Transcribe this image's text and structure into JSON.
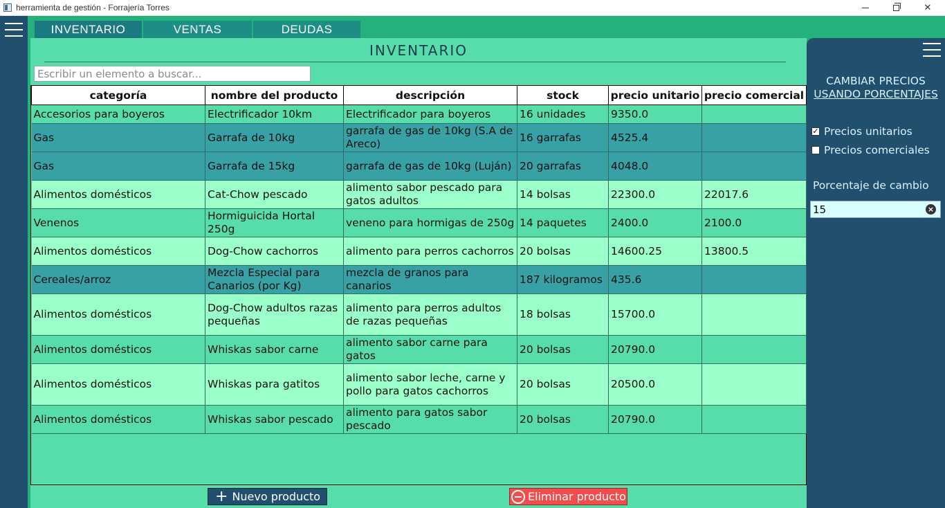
{
  "window": {
    "title": "herramienta de gestión - Forrajería Torres",
    "icon": "app-window-icon"
  },
  "tabs": [
    {
      "label": "INVENTARIO",
      "active": true
    },
    {
      "label": "VENTAS",
      "active": false
    },
    {
      "label": "DEUDAS",
      "active": false
    }
  ],
  "page": {
    "title": "INVENTARIO",
    "search_placeholder": "Escribir un elemento a buscar..."
  },
  "table": {
    "columns": [
      "categoría",
      "nombre del producto",
      "descripción",
      "stock",
      "precio unitario",
      "precio comercial"
    ],
    "rows": [
      {
        "color": "mint",
        "cells": [
          "Accesorios para boyeros",
          "Electrificador 10km",
          "Electrificador para boyeros",
          "16 unidades",
          "9350.0",
          ""
        ]
      },
      {
        "color": "teal",
        "cells": [
          "Gas",
          "Garrafa de 10kg",
          "garrafa de gas de 10kg (S.A de Areco)",
          "16 garrafas",
          "4525.4",
          ""
        ]
      },
      {
        "color": "teal",
        "cells": [
          "Gas",
          "Garrafa de 15kg",
          "garrafa de gas de 10kg (Luján)",
          "20 garrafas",
          "4048.0",
          ""
        ]
      },
      {
        "color": "light",
        "cells": [
          "Alimentos domésticos",
          "Cat-Chow pescado",
          "alimento sabor pescado para gatos adultos",
          "14 bolsas",
          "22300.0",
          "22017.6"
        ]
      },
      {
        "color": "mint",
        "cells": [
          "Venenos",
          "Hormiguicida Hortal 250g",
          "veneno para hormigas de 250g",
          "14 paquetes",
          "2400.0",
          "2100.0"
        ]
      },
      {
        "color": "light",
        "cells": [
          "Alimentos domésticos",
          "Dog-Chow cachorros",
          "alimento para perros cachorros",
          "20 bolsas",
          "14600.25",
          "13800.5"
        ]
      },
      {
        "color": "teal",
        "cells": [
          "Cereales/arroz",
          "Mezcla Especial para Canarios (por Kg)",
          "mezcla de granos para canarios",
          "187 kilogramos",
          "435.6",
          ""
        ]
      },
      {
        "color": "light",
        "cells": [
          "Alimentos domésticos",
          "Dog-Chow adultos razas pequeñas",
          "alimento para perros adultos de razas pequeñas",
          "18 bolsas",
          "15700.0",
          ""
        ]
      },
      {
        "color": "mint",
        "cells": [
          "Alimentos domésticos",
          "Whiskas sabor carne",
          "alimento sabor carne para gatos",
          "20 bolsas",
          "20790.0",
          ""
        ]
      },
      {
        "color": "light",
        "cells": [
          "Alimentos domésticos",
          "Whiskas para gatitos",
          "alimento sabor leche, carne y pollo para gatos cachorros",
          "20 bolsas",
          "20500.0",
          ""
        ]
      },
      {
        "color": "mint",
        "cells": [
          "Alimentos domésticos",
          "Whiskas sabor pescado",
          "alimento para gatos sabor pescado",
          "20 bolsas",
          "20790.0",
          ""
        ]
      }
    ]
  },
  "buttons": {
    "new_product": "Nuevo producto",
    "delete_product": "Eliminar producto"
  },
  "price_panel": {
    "title_line1": "CAMBIAR PRECIOS",
    "title_line2": "USANDO PORCENTAJES",
    "unit_prices_label": "Precios unitarios",
    "unit_prices_checked": true,
    "commercial_prices_label": "Precios comerciales",
    "commercial_prices_checked": false,
    "percentage_label": "Porcentaje de cambio",
    "percentage_value": "15"
  },
  "colors": {
    "app_green": "#25b07c",
    "content_mint": "#57ddaa",
    "row_teal": "#37a1a6",
    "row_light": "#9affc9",
    "navy": "#214f6e",
    "delete_red": "#f24c4c"
  }
}
